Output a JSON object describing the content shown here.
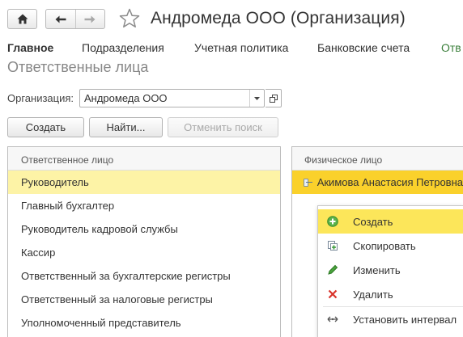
{
  "window": {
    "title": "Андромеда ООО (Организация)"
  },
  "nav": {
    "home_icon": "home-icon",
    "back_icon": "arrow-left-icon",
    "forward_icon": "arrow-right-icon",
    "favorite_icon": "star-icon"
  },
  "tabs": [
    {
      "label": "Главное",
      "active": true
    },
    {
      "label": "Подразделения",
      "active": false
    },
    {
      "label": "Учетная политика",
      "active": false
    },
    {
      "label": "Банковские счета",
      "active": false
    },
    {
      "label": "Отв",
      "active": false
    }
  ],
  "section": {
    "title": "Ответственные лица"
  },
  "filter": {
    "org_label": "Организация:",
    "org_value": "Андромеда ООО"
  },
  "toolbar": {
    "create_label": "Создать",
    "find_label": "Найти...",
    "cancel_search_label": "Отменить поиск"
  },
  "left_table": {
    "header": "Ответственное лицо",
    "rows": [
      "Руководитель",
      "Главный бухгалтер",
      "Руководитель кадровой службы",
      "Кассир",
      "Ответственный за бухгалтерские регистры",
      "Ответственный за налоговые регистры",
      "Уполномоченный представитель"
    ],
    "selected_index": 0
  },
  "right_table": {
    "header": "Физическое лицо",
    "rows": [
      "Акимова Анастасия Петровна"
    ]
  },
  "context_menu": {
    "items": [
      {
        "label": "Создать",
        "icon": "add-icon"
      },
      {
        "label": "Скопировать",
        "icon": "copy-icon"
      },
      {
        "label": "Изменить",
        "icon": "edit-pencil-icon"
      },
      {
        "label": "Удалить",
        "icon": "delete-x-icon"
      },
      {
        "label": "Установить интервал",
        "icon": "interval-icon"
      }
    ]
  },
  "colors": {
    "tab_active": "#333333",
    "tab_link": "#3b7f3b",
    "row_selected": "#fdf3a6",
    "person_selected": "#fad12b",
    "menu_highlight": "#fce65a"
  }
}
